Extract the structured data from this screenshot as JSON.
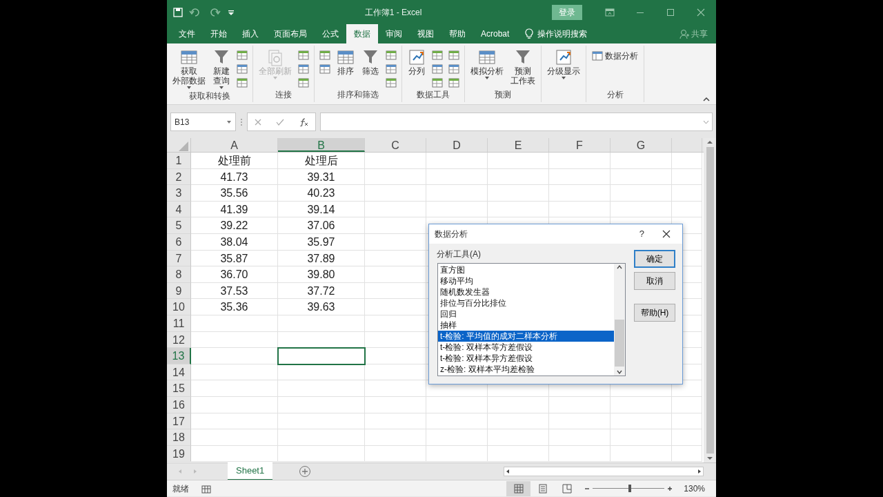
{
  "title_bar": {
    "title": "工作簿1 - Excel",
    "sign_in": "登录"
  },
  "tabs": [
    {
      "label": "文件",
      "selected": false
    },
    {
      "label": "开始",
      "selected": false
    },
    {
      "label": "插入",
      "selected": false
    },
    {
      "label": "页面布局",
      "selected": false
    },
    {
      "label": "公式",
      "selected": false
    },
    {
      "label": "数据",
      "selected": true
    },
    {
      "label": "审阅",
      "selected": false
    },
    {
      "label": "视图",
      "selected": false
    },
    {
      "label": "帮助",
      "selected": false
    },
    {
      "label": "Acrobat",
      "selected": false
    }
  ],
  "tell_me": "操作说明搜索",
  "share": "共享",
  "ribbon_groups": [
    {
      "label": "获取和转换",
      "commands": [
        {
          "kind": "large",
          "lines": [
            "获取",
            "外部数据"
          ],
          "dropdown": true,
          "disabled": false
        },
        {
          "kind": "large",
          "lines": [
            "新建",
            "查询"
          ],
          "dropdown": true,
          "disabled": false
        },
        {
          "kind": "stack",
          "items": [
            {
              "kind": "icon"
            },
            {
              "kind": "icon"
            },
            {
              "kind": "icon"
            }
          ]
        }
      ]
    },
    {
      "label": "连接",
      "commands": [
        {
          "kind": "large",
          "lines": [
            "全部刷新"
          ],
          "dropdown": true,
          "disabled": true
        },
        {
          "kind": "stack",
          "items": [
            {
              "kind": "icon"
            },
            {
              "kind": "icon"
            },
            {
              "kind": "icon"
            }
          ]
        }
      ]
    },
    {
      "label": "排序和筛选",
      "commands": [
        {
          "kind": "stack",
          "items": [
            {
              "kind": "icon"
            },
            {
              "kind": "icon"
            }
          ]
        },
        {
          "kind": "large",
          "lines": [
            "排序"
          ],
          "dropdown": false,
          "disabled": false
        },
        {
          "kind": "large",
          "lines": [
            "筛选"
          ],
          "dropdown": false,
          "disabled": false
        },
        {
          "kind": "stack",
          "items": [
            {
              "kind": "icon"
            },
            {
              "kind": "icon"
            },
            {
              "kind": "icon"
            }
          ]
        }
      ]
    },
    {
      "label": "数据工具",
      "commands": [
        {
          "kind": "large",
          "lines": [
            "分列"
          ],
          "dropdown": false,
          "disabled": false
        },
        {
          "kind": "stack",
          "items": [
            {
              "kind": "icon"
            },
            {
              "kind": "icon"
            },
            {
              "kind": "icon"
            }
          ]
        },
        {
          "kind": "stack",
          "items": [
            {
              "kind": "icon"
            },
            {
              "kind": "icon"
            },
            {
              "kind": "icon"
            }
          ]
        }
      ]
    },
    {
      "label": "预测",
      "commands": [
        {
          "kind": "large",
          "lines": [
            "模拟分析"
          ],
          "dropdown": true,
          "disabled": false
        },
        {
          "kind": "large",
          "lines": [
            "预测",
            "工作表"
          ],
          "dropdown": false,
          "disabled": false
        }
      ]
    },
    {
      "commands": [
        {
          "kind": "large",
          "lines": [
            "分级显示"
          ],
          "dropdown": true,
          "disabled": false
        }
      ]
    },
    {
      "label": "分析",
      "commands": [
        {
          "kind": "small",
          "lines": [
            "数据分析"
          ],
          "dropdown": false,
          "disabled": false
        }
      ]
    }
  ],
  "name_box": "B13",
  "columns": [
    {
      "label": "A",
      "selected": false
    },
    {
      "label": "B",
      "selected": true
    },
    {
      "label": "C",
      "selected": false
    },
    {
      "label": "D",
      "selected": false
    },
    {
      "label": "E",
      "selected": false
    },
    {
      "label": "F",
      "selected": false
    },
    {
      "label": "G",
      "selected": false
    }
  ],
  "rows": [
    {
      "number": "1",
      "selected": false,
      "cells": [
        "处理前",
        "处理后"
      ]
    },
    {
      "number": "2",
      "selected": false,
      "cells": [
        "41.73",
        "39.31"
      ]
    },
    {
      "number": "3",
      "selected": false,
      "cells": [
        "35.56",
        "40.23"
      ]
    },
    {
      "number": "4",
      "selected": false,
      "cells": [
        "41.39",
        "39.14"
      ]
    },
    {
      "number": "5",
      "selected": false,
      "cells": [
        "39.22",
        "37.06"
      ]
    },
    {
      "number": "6",
      "selected": false,
      "cells": [
        "38.04",
        "35.97"
      ]
    },
    {
      "number": "7",
      "selected": false,
      "cells": [
        "35.87",
        "37.89"
      ]
    },
    {
      "number": "8",
      "selected": false,
      "cells": [
        "36.70",
        "39.80"
      ]
    },
    {
      "number": "9",
      "selected": false,
      "cells": [
        "37.53",
        "37.72"
      ]
    },
    {
      "number": "10",
      "selected": false,
      "cells": [
        "35.36",
        "39.63"
      ]
    },
    {
      "number": "11",
      "selected": false
    },
    {
      "number": "12",
      "selected": false
    },
    {
      "number": "13",
      "selected": true
    },
    {
      "number": "14",
      "selected": false
    },
    {
      "number": "15",
      "selected": false
    },
    {
      "number": "16",
      "selected": false
    },
    {
      "number": "17",
      "selected": false
    },
    {
      "number": "18",
      "selected": false
    },
    {
      "number": "19",
      "selected": false
    }
  ],
  "sheet_tabs": [
    {
      "label": "Sheet1",
      "selected": true
    }
  ],
  "status_bar": {
    "text": "就绪",
    "views": [
      {
        "selected": true
      },
      {
        "selected": false
      },
      {
        "selected": false
      }
    ],
    "zoom": {
      "level": 0.52,
      "reading": "130%"
    }
  },
  "dialog": {
    "title": "数据分析",
    "help": "?",
    "list_label": "分析工具(A)",
    "items": [
      {
        "label": "直方图",
        "selected": false
      },
      {
        "label": "移动平均",
        "selected": false
      },
      {
        "label": "随机数发生器",
        "selected": false
      },
      {
        "label": "排位与百分比排位",
        "selected": false
      },
      {
        "label": "回归",
        "selected": false
      },
      {
        "label": "抽样",
        "selected": false
      },
      {
        "label": "t-检验: 平均值的成对二样本分析",
        "selected": true
      },
      {
        "label": "t-检验: 双样本等方差假设",
        "selected": false
      },
      {
        "label": "t-检验: 双样本异方差假设",
        "selected": false
      },
      {
        "label": "z-检验: 双样本平均差检验",
        "selected": false
      }
    ],
    "buttons": [
      {
        "label": "确定",
        "default": true
      },
      {
        "label": "取消",
        "default": false
      },
      {
        "label": "帮助(H)",
        "default": false
      }
    ]
  }
}
